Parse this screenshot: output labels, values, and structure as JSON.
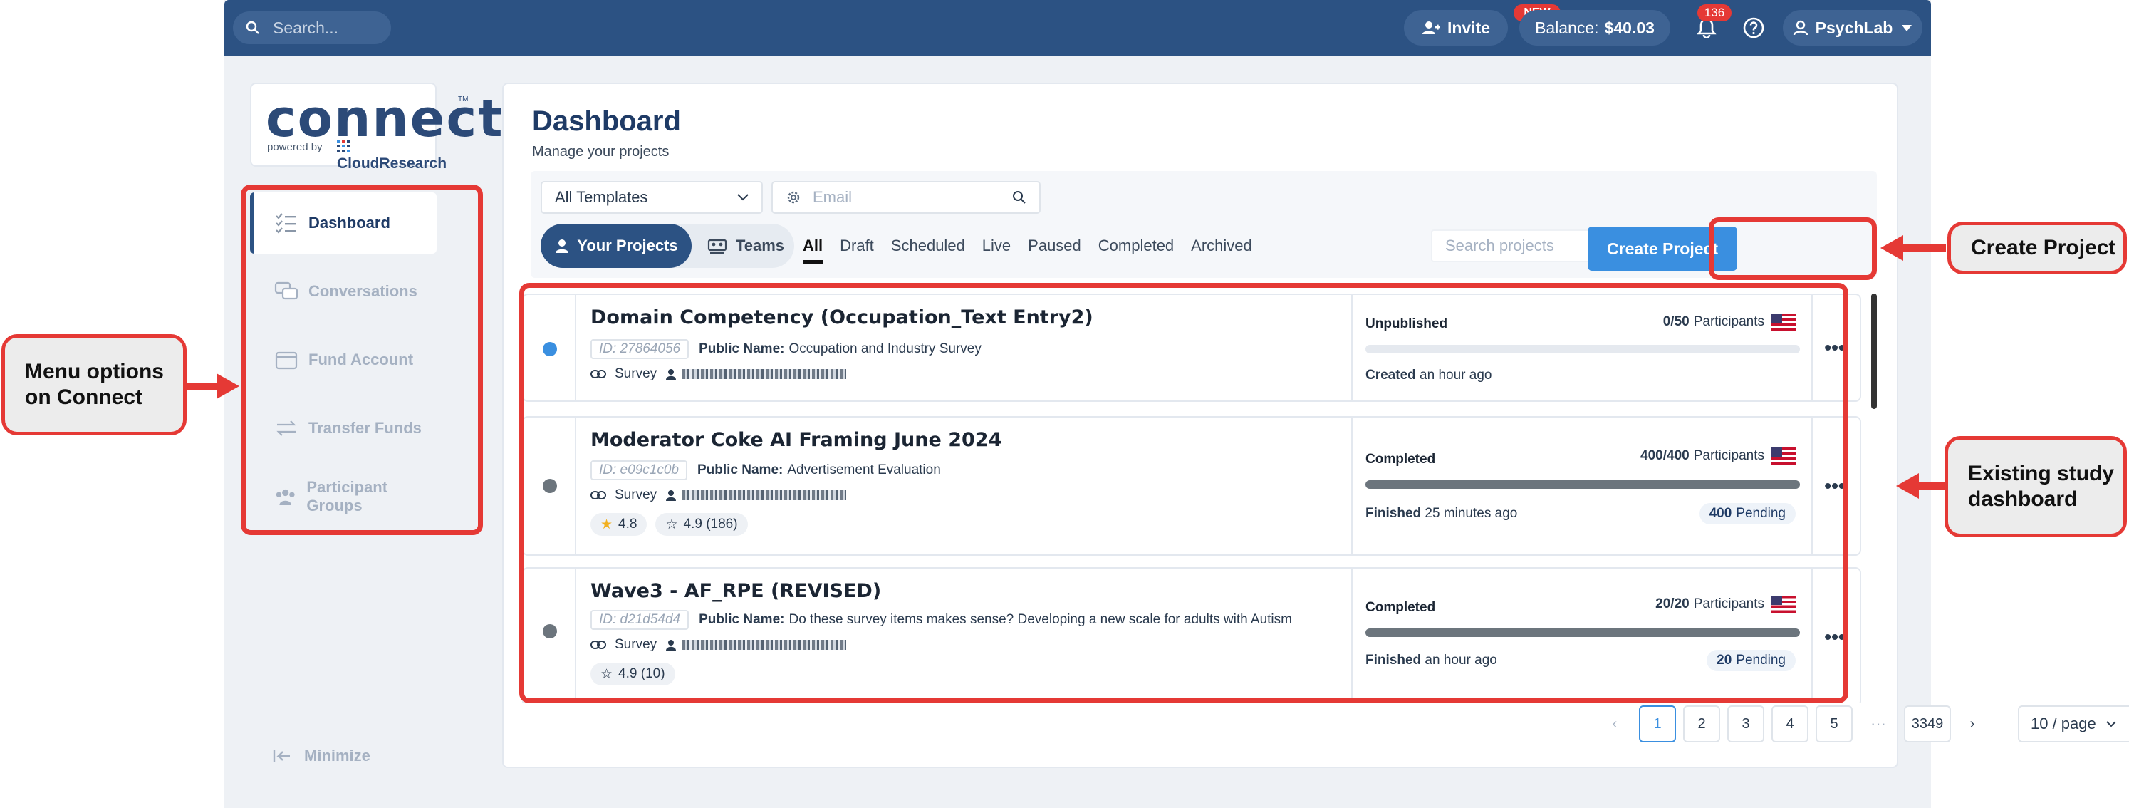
{
  "topbar": {
    "search_placeholder": "Search...",
    "invite_label": "Invite",
    "new_badge": "NEW",
    "balance_label": "Balance:",
    "balance_value": "$40.03",
    "notification_count": "136",
    "user_label": "PsychLab"
  },
  "logo": {
    "wordmark": "connect",
    "tm": "TM",
    "powered_by": "powered by",
    "brand": "CloudResearch"
  },
  "sidebar": {
    "items": [
      {
        "label": "Dashboard",
        "icon": "checklist-icon"
      },
      {
        "label": "Conversations",
        "icon": "chat-bubbles-icon"
      },
      {
        "label": "Fund Account",
        "icon": "wallet-icon"
      },
      {
        "label": "Transfer Funds",
        "icon": "transfer-arrows-icon"
      },
      {
        "label": "Participant Groups",
        "icon": "group-icon"
      }
    ],
    "minimize_label": "Minimize"
  },
  "main": {
    "title": "Dashboard",
    "subtitle": "Manage your projects",
    "template_select": "All Templates",
    "email_placeholder": "Email",
    "toggle": {
      "yours": "Your Projects",
      "teams": "Teams"
    },
    "status_tabs": [
      "All",
      "Draft",
      "Scheduled",
      "Live",
      "Paused",
      "Completed",
      "Archived"
    ],
    "search_projects_placeholder": "Search projects",
    "create_button": "Create Project"
  },
  "studies": [
    {
      "title": "Domain Competency (Occupation_Text Entry2)",
      "id": "ID: 27864056",
      "public_name_label": "Public Name:",
      "public_name": "Occupation and Industry Survey",
      "type": "Survey",
      "status": "Unpublished",
      "participants_count": "0/50",
      "participants_label": "Participants",
      "progress": 0,
      "foot_bold": "Created",
      "foot_text": "an hour ago",
      "dot_color": "#3a8fe0"
    },
    {
      "title": "Moderator Coke AI Framing June 2024",
      "id": "ID: e09c1c0b",
      "public_name_label": "Public Name:",
      "public_name": "Advertisement Evaluation",
      "type": "Survey",
      "rating_star": "4.8",
      "rating_outline": "4.9 (186)",
      "status": "Completed",
      "participants_count": "400/400",
      "participants_label": "Participants",
      "progress": 1,
      "foot_bold": "Finished",
      "foot_text": "25 minutes ago",
      "pending_count": "400",
      "pending_label": "Pending",
      "dot_color": "#6c757d"
    },
    {
      "title": "Wave3 - AF_RPE (REVISED)",
      "id": "ID: d21d54d4",
      "public_name_label": "Public Name:",
      "public_name": "Do these survey items makes sense? Developing a new scale for adults with Autism",
      "type": "Survey",
      "rating_outline": "4.9 (10)",
      "status": "Completed",
      "participants_count": "20/20",
      "participants_label": "Participants",
      "progress": 1,
      "foot_bold": "Finished",
      "foot_text": "an hour ago",
      "pending_count": "20",
      "pending_label": "Pending",
      "dot_color": "#6c757d"
    }
  ],
  "pagination": {
    "pages": [
      "1",
      "2",
      "3",
      "4",
      "5"
    ],
    "ellipsis": "···",
    "last": "3349",
    "per_page": "10 / page"
  },
  "annotations": {
    "menu_callout": "Menu options on Connect",
    "create_callout": "Create Project",
    "dashboard_callout": "Existing study dashboard",
    "accent": "#e53935"
  }
}
